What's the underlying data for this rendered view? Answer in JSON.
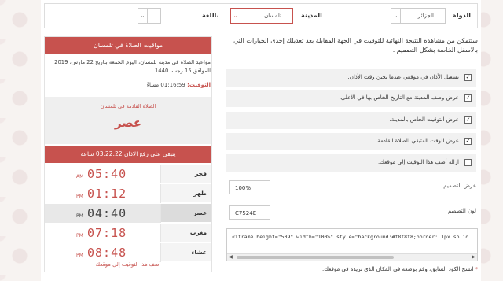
{
  "filters": {
    "country_label": "الدولة",
    "country_value": "الجزائر",
    "city_label": "المدينة",
    "city_value": "تلمسان",
    "language_label": "باللغة",
    "language_value": ""
  },
  "settings": {
    "intro": "ستتمكن من مشاهدة النتيجة النهائية للتوقيت في الجهة المقابلة بعد تعديلك إحدى الخيارات التي بالاسفل الخاصة بشكل التصميم .",
    "options": [
      {
        "label": "تشغيل الأذان في موقعي عندما يحين وقت الأذان.",
        "checked": true
      },
      {
        "label": "عرض وصف المدينة مع التاريخ الخاص بها في الأعلى.",
        "checked": true
      },
      {
        "label": "عرض التوقيت الخاص بالمدينة.",
        "checked": true
      },
      {
        "label": "عرض الوقت المتبقي للصلاة القادمة.",
        "checked": true
      },
      {
        "label": "ازالة أضف هذا التوقيت إلى موقعك.",
        "checked": false
      }
    ],
    "width_label": "عرض التصميم",
    "width_value": "100%",
    "color_label": "لون التصميم",
    "color_value": "C7524E",
    "embed_code": "<iframe height=\"509\" width=\"100%\" style=\"background:#f8f8f8;border: 1px solid",
    "copy_note": "انسخ الكود السابق، وقم بوضعه في المكان الذي تريده في موقعك."
  },
  "widget": {
    "title": "مواقيت الصلاة في تلمسان",
    "info": "مواعيد الصلاة في مدينة تلمسان، اليوم الجمعة بتاريخ 22 مارس، 2019 الموافق 15 رجب، 1440.",
    "time_label": "التوقيت:",
    "time_value": "01:16:59 مساءً",
    "next_caption": "الصلاة القادمة في تلمسان",
    "next_name": "عصر",
    "remaining": "يتبقى على رفع الاذان  03:22:22 ساعة",
    "prayers": [
      {
        "name": "فجر",
        "time": "05:40",
        "period": "AM",
        "current": false
      },
      {
        "name": "ظهر",
        "time": "01:12",
        "period": "PM",
        "current": false
      },
      {
        "name": "عصر",
        "time": "04:40",
        "period": "PM",
        "current": true
      },
      {
        "name": "مغرب",
        "time": "07:18",
        "period": "PM",
        "current": false
      },
      {
        "name": "عشاء",
        "time": "08:48",
        "period": "PM",
        "current": false
      }
    ],
    "footer_link": "أضف هذا التوقيت إلى موقعك"
  },
  "colors": {
    "accent": "#c7524e"
  },
  "icons": {
    "select_caret": "chevron-down-icon",
    "checkbox": "check-icon"
  }
}
